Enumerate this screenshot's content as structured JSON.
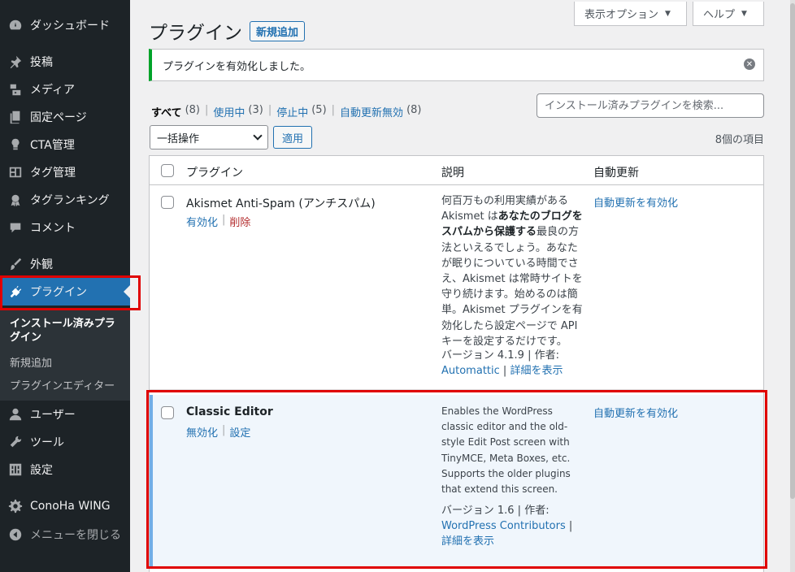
{
  "sidebar": {
    "items": [
      {
        "label": "ダッシュボード",
        "icon": "dashboard-icon"
      },
      {
        "label": "投稿",
        "icon": "pin-icon"
      },
      {
        "label": "メディア",
        "icon": "media-icon"
      },
      {
        "label": "固定ページ",
        "icon": "page-icon"
      },
      {
        "label": "CTA管理",
        "icon": "lightbulb-icon"
      },
      {
        "label": "タグ管理",
        "icon": "layout-icon"
      },
      {
        "label": "タグランキング",
        "icon": "award-icon"
      },
      {
        "label": "コメント",
        "icon": "comment-icon"
      },
      {
        "label": "外観",
        "icon": "brush-icon"
      },
      {
        "label": "プラグイン",
        "icon": "plugin-icon"
      },
      {
        "label": "ユーザー",
        "icon": "user-icon"
      },
      {
        "label": "ツール",
        "icon": "wrench-icon"
      },
      {
        "label": "設定",
        "icon": "settings-icon"
      },
      {
        "label": "ConoHa WING",
        "icon": "gear-icon"
      },
      {
        "label": "メニューを閉じる",
        "icon": "collapse-icon"
      }
    ],
    "submenu": {
      "installed": "インストール済みプラグイン",
      "add_new": "新規追加",
      "editor": "プラグインエディター"
    }
  },
  "header": {
    "screen_options": "表示オプション",
    "help": "ヘルプ",
    "title": "プラグイン",
    "add_new": "新規追加"
  },
  "notice": {
    "message": "プラグインを有効化しました。"
  },
  "filters": {
    "all": {
      "label": "すべて",
      "count": "(8)"
    },
    "active": {
      "label": "使用中",
      "count": "(3)"
    },
    "inactive": {
      "label": "停止中",
      "count": "(5)"
    },
    "auto_disabled": {
      "label": "自動更新無効",
      "count": "(8)"
    }
  },
  "search": {
    "placeholder": "インストール済みプラグインを検索..."
  },
  "bulk": {
    "selected": "一括操作",
    "apply": "適用",
    "item_count": "8個の項目"
  },
  "table": {
    "headers": {
      "plugin": "プラグイン",
      "description": "説明",
      "auto_update": "自動更新"
    },
    "rows": [
      {
        "name": "Akismet Anti-Spam (アンチスパム)",
        "action1": "有効化",
        "action2": "削除",
        "description_pre": "何百万もの利用実績がある Akismet は",
        "description_bold": "あなたのブログをスパムから保護する",
        "description_post": "最良の方法といえるでしょう。あなたが眠りについている時間でさえ、Akismet は常時サイトを守り続けます。始めるのは簡単。Akismet プラグインを有効化したら設定ページで API キーを設定するだけです。",
        "version": "バージョン 4.1.9 | 作者:",
        "author": "Automattic",
        "details": "詳細を表示",
        "auto_update": "自動更新を有効化"
      },
      {
        "name": "Classic Editor",
        "action1": "無効化",
        "action2": "設定",
        "description": "Enables the WordPress classic editor and the old-style Edit Post screen with TinyMCE, Meta Boxes, etc. Supports the older plugins that extend this screen.",
        "version": "バージョン 1.6 | 作者:",
        "author": "WordPress Contributors",
        "details": "詳細を表示",
        "auto_update": "自動更新を有効化"
      }
    ]
  },
  "colors": {
    "sidebar_bg": "#1d2327",
    "accent": "#2271b1",
    "highlight_box": "#e00000",
    "notice_success": "#00a32a"
  }
}
